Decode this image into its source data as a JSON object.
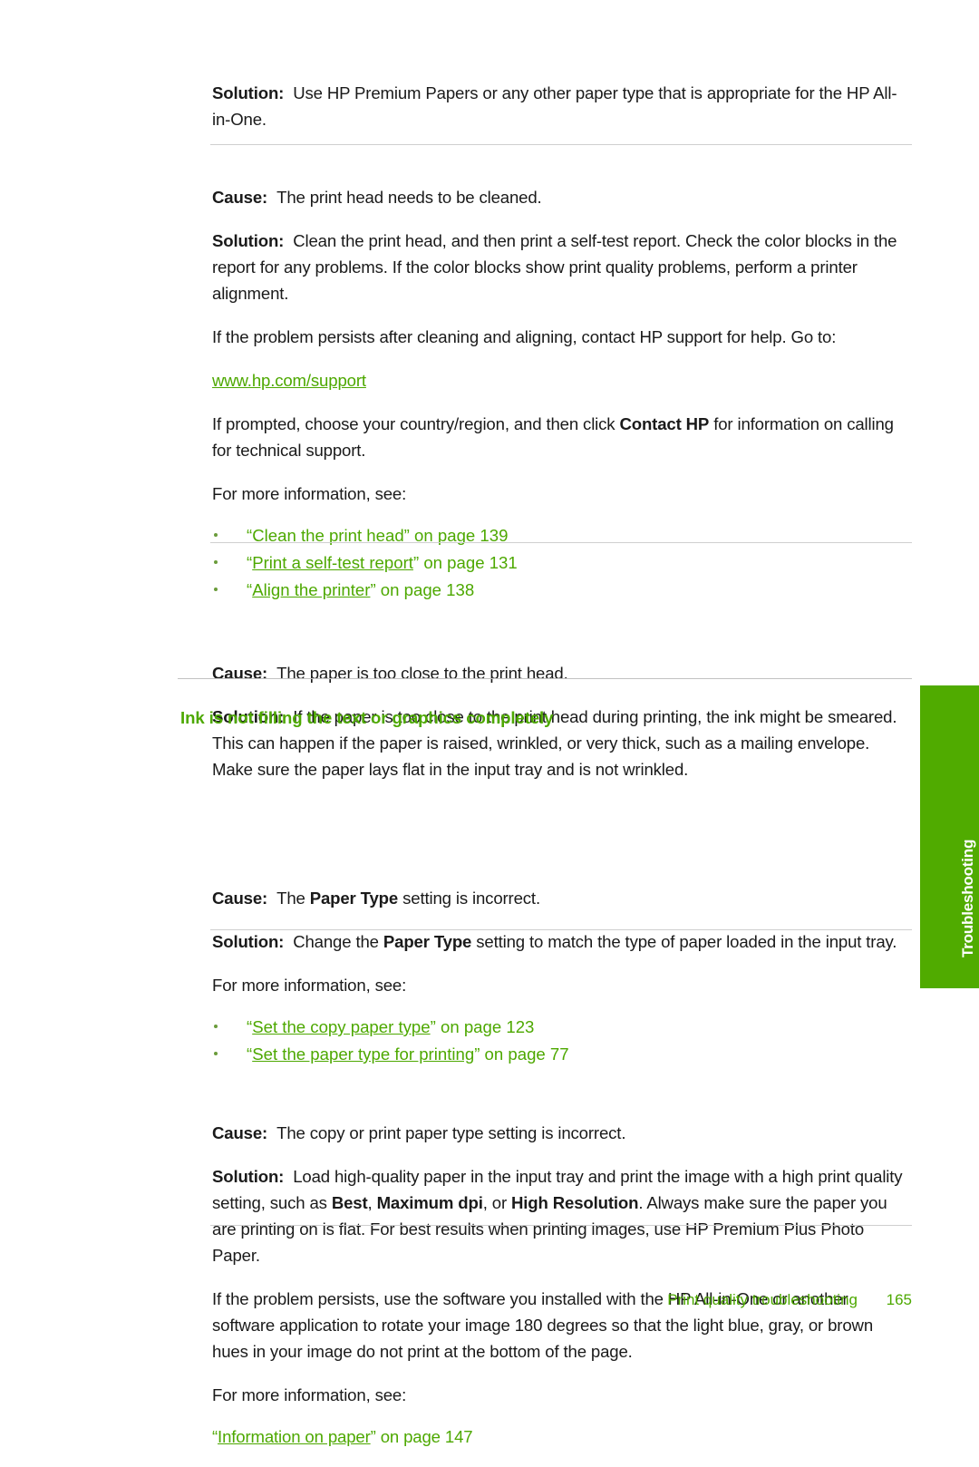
{
  "document": {
    "page_number": "165",
    "footer_title": "Print quality troubleshooting",
    "side_tab_label": "Troubleshooting",
    "accent_green": "#4da800",
    "tab_green": "#50ab00",
    "rule_color": "#cfcfcf"
  },
  "blocks": {
    "solution_1": {
      "lead": "Solution:",
      "text": "Use HP Premium Papers or any other paper type that is appropriate for the HP All-in-One."
    },
    "cause_1": {
      "lead": "Cause:",
      "text": "The print head needs to be cleaned."
    },
    "solution_2": {
      "lead": "Solution:",
      "text": "Clean the print head, and then print a self-test report. Check the color blocks in the report for any problems. If the color blocks show print quality problems, perform a printer alignment."
    },
    "persist_1": {
      "text": "If the problem persists after cleaning and aligning, contact HP support for help. Go to:"
    },
    "support_url": "www.hp.com/support",
    "prompted": {
      "text_before": "If prompted, choose your country/region, and then click ",
      "bold": "Contact HP",
      "text_after": " for information on calling for technical support."
    },
    "more_info_1": "For more information, see:",
    "links_1": [
      {
        "quote_open": "“",
        "title": "Clean the print head",
        "quote_close": "”",
        "tail": " on page 139"
      },
      {
        "quote_open": "“",
        "title": "Print a self-test report",
        "quote_close": "”",
        "tail": " on page 131"
      },
      {
        "quote_open": "“",
        "title": "Align the printer",
        "quote_close": "”",
        "tail": " on page 138"
      }
    ],
    "cause_2": {
      "lead": "Cause:",
      "text": "The paper is too close to the print head."
    },
    "solution_3": {
      "lead": "Solution:",
      "text": "If the paper is too close to the print head during printing, the ink might be smeared. This can happen if the paper is raised, wrinkled, or very thick, such as a mailing envelope. Make sure the paper lays flat in the input tray and is not wrinkled."
    },
    "section_heading": "Ink is not filling the text or graphics completely",
    "cause_3": {
      "lead": "Cause:",
      "text_before": "The ",
      "bold": "Paper Type",
      "text_after": " setting is incorrect."
    },
    "solution_4": {
      "lead": "Solution:",
      "text_before": "Change the ",
      "bold": "Paper Type",
      "text_after": " setting to match the type of paper loaded in the input tray."
    },
    "more_info_2": "For more information, see:",
    "links_2": [
      {
        "quote_open": "“",
        "title": "Set the copy paper type",
        "quote_close": "”",
        "tail": " on page 123"
      },
      {
        "quote_open": "“",
        "title": "Set the paper type for printing",
        "quote_close": "”",
        "tail": " on page 77"
      }
    ],
    "cause_4": {
      "lead": "Cause:",
      "text": "The copy or print paper type setting is incorrect."
    },
    "solution_5": {
      "lead": "Solution:",
      "part1": "Load high-quality paper in the input tray and print the image with a high print quality setting, such as ",
      "bold1": "Best",
      "sep1": ", ",
      "bold2": "Maximum dpi",
      "sep2": ", or ",
      "bold3": "High Resolution",
      "part2": ". Always make sure the paper you are printing on is flat. For best results when printing images, use HP Premium Plus Photo Paper."
    },
    "persist_2": {
      "text": "If the problem persists, use the software you installed with the HP All-in-One or another software application to rotate your image 180 degrees so that the light blue, gray, or brown hues in your image do not print at the bottom of the page."
    },
    "more_info_3": "For more information, see:",
    "link_3": {
      "quote_open": "“",
      "title": "Information on paper",
      "quote_close": "”",
      "tail": " on page 147"
    }
  }
}
